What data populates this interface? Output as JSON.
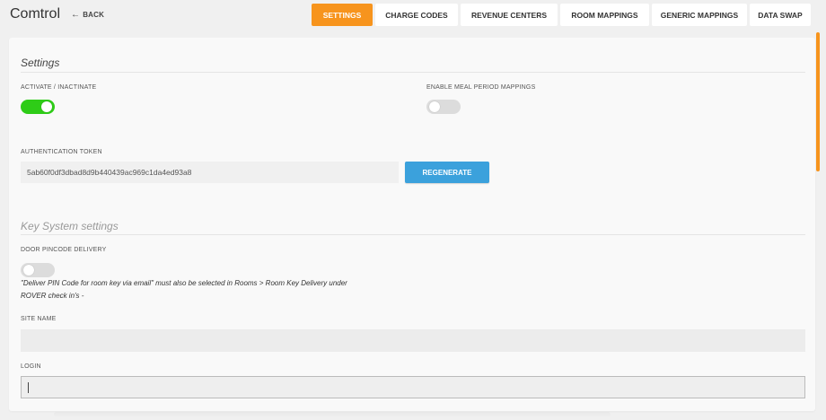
{
  "header": {
    "app_title": "Comtrol",
    "back_label": "BACK",
    "tabs": [
      {
        "label": "SETTINGS",
        "active": true
      },
      {
        "label": "CHARGE CODES",
        "active": false
      },
      {
        "label": "REVENUE CENTERS",
        "active": false
      },
      {
        "label": "ROOM MAPPINGS",
        "active": false
      },
      {
        "label": "GENERIC MAPPINGS",
        "active": false
      },
      {
        "label": "DATA SWAP",
        "active": false
      }
    ]
  },
  "settings": {
    "title": "Settings",
    "activate_label": "ACTIVATE / INACTINATE",
    "activate_on": true,
    "meal_label": "ENABLE MEAL PERIOD MAPPINGS",
    "meal_on": false,
    "auth_label": "AUTHENTICATION TOKEN",
    "auth_token": "5ab60f0df3dbad8d9b440439ac969c1da4ed93a8",
    "regenerate_label": "REGENERATE"
  },
  "key_system": {
    "title": "Key System settings",
    "door_label": "DOOR PINCODE DELIVERY",
    "door_on": false,
    "note_line1": "\"Deliver PIN Code for room key via email\" must also be selected in Rooms > Room Key Delivery under",
    "note_line2": "ROVER check in's -",
    "site_label": "SITE NAME",
    "site_value": "",
    "login_label": "LOGIN",
    "login_value": ""
  },
  "colors": {
    "accent": "#f7941d",
    "toggle_on": "#2ecc17",
    "button": "#3ba1dc"
  }
}
